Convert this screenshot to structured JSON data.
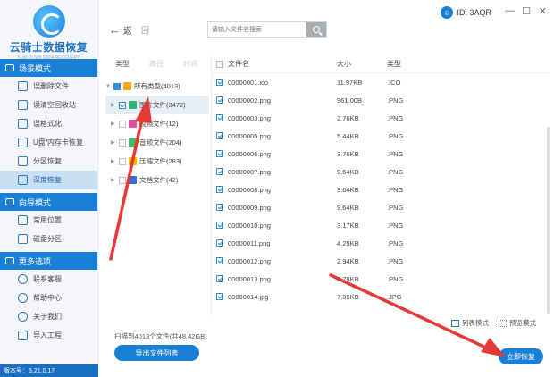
{
  "app": {
    "title": "云骑士数据恢复",
    "subtitle": "YUN QI SHI DATA RECOVERY",
    "version": "版本号：3.21.0.17",
    "user_id": "ID: 3AQR"
  },
  "sidebar": {
    "sections": [
      {
        "title": "场景模式",
        "items": [
          "误删除文件",
          "误清空回收站",
          "误格式化",
          "U盘/内存卡恢复",
          "分区恢复",
          "深度恢复"
        ],
        "active": 5
      },
      {
        "title": "向导模式",
        "items": [
          "常用位置",
          "磁盘分区"
        ]
      },
      {
        "title": "更多选项",
        "items": [
          "联系客服",
          "帮助中心",
          "关于我们",
          "导入工程"
        ]
      }
    ]
  },
  "toolbar": {
    "back_label": "返",
    "back2_label": "回",
    "search_placeholder": "请输入文件名搜索"
  },
  "tree": {
    "tabs": [
      "类型",
      "路径",
      "时间"
    ],
    "rows": [
      {
        "label": "所有类型(4013)",
        "state": "partial",
        "icon_color": "#f5a623",
        "level": 0
      },
      {
        "label": "图片文件(3472)",
        "state": "checked",
        "icon_color": "#2bb673",
        "level": 1,
        "selected": true
      },
      {
        "label": "视频文件(12)",
        "state": "none",
        "icon_color": "#e14fa3",
        "level": 1
      },
      {
        "label": "音频文件(204)",
        "state": "none",
        "icon_color": "#3cc06e",
        "level": 1
      },
      {
        "label": "压缩文件(283)",
        "state": "none",
        "icon_color": "#f5b800",
        "level": 1
      },
      {
        "label": "文档文件(42)",
        "state": "none",
        "icon_color": "#3a6ad4",
        "level": 1
      }
    ]
  },
  "filelist": {
    "headers": {
      "name": "文件名",
      "size": "大小",
      "type": "类型"
    },
    "rows": [
      {
        "name": "00000001.ico",
        "size": "11.97KB",
        "type": ".ICO"
      },
      {
        "name": "00000002.png",
        "size": "961.00B",
        "type": ".PNG"
      },
      {
        "name": "00000003.png",
        "size": "2.76KB",
        "type": ".PNG"
      },
      {
        "name": "00000005.png",
        "size": "5.44KB",
        "type": ".PNG"
      },
      {
        "name": "00000006.png",
        "size": "3.76KB",
        "type": ".PNG"
      },
      {
        "name": "00000007.png",
        "size": "9.64KB",
        "type": ".PNG"
      },
      {
        "name": "00000008.png",
        "size": "9.64KB",
        "type": ".PNG"
      },
      {
        "name": "00000009.png",
        "size": "9.64KB",
        "type": ".PNG"
      },
      {
        "name": "00000010.png",
        "size": "3.17KB",
        "type": ".PNG"
      },
      {
        "name": "00000011.png",
        "size": "4.25KB",
        "type": ".PNG"
      },
      {
        "name": "00000012.png",
        "size": "2.94KB",
        "type": ".PNG"
      },
      {
        "name": "00000013.png",
        "size": "3.76KB",
        "type": ".PNG"
      },
      {
        "name": "00000014.jpg",
        "size": "7.36KB",
        "type": ".JPG"
      }
    ]
  },
  "footer": {
    "found_text": "扫描到4013个文件(共48.42GB)",
    "export_label": "导出文件列表",
    "list_mode": "列表模式",
    "preview_mode": "预览模式",
    "recover_label": "立即恢复"
  },
  "colors": {
    "accent": "#1a7fd6",
    "annotation": "#e53935"
  }
}
